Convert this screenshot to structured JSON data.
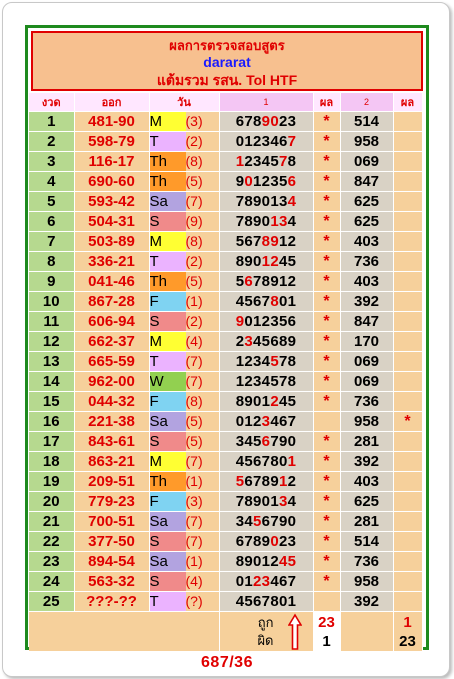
{
  "header": {
    "line1": "ผลการตรวจสอบสูตร",
    "line2": "dararat",
    "line3": "แต้มรวม รสน. Tol HTF"
  },
  "columns": [
    "งวด",
    "ออก",
    "วัน",
    "1",
    "ผล",
    "2",
    "ผล"
  ],
  "day_colors": {
    "M": "#ffff33",
    "T": "#ebb3ff",
    "Th": "#ff9a2a",
    "Sa": "#b2a3e0",
    "S": "#f08a8a",
    "W": "#92d050",
    "F": "#7fd3f2"
  },
  "rows": [
    {
      "n": "1",
      "out": "481-90",
      "day": "M",
      "dnum": "(3)",
      "s1": "6789023",
      "r1": "*",
      "s2": "514",
      "r2": ""
    },
    {
      "n": "2",
      "out": "598-79",
      "day": "T",
      "dnum": "(2)",
      "s1": "0123467",
      "r1": "*",
      "s2": "958",
      "r2": ""
    },
    {
      "n": "3",
      "out": "116-17",
      "day": "Th",
      "dnum": "(8)",
      "s1": "1234578",
      "r1": "*",
      "s2": "069",
      "r2": ""
    },
    {
      "n": "4",
      "out": "690-60",
      "day": "Th",
      "dnum": "(5)",
      "s1": "9012356",
      "r1": "*",
      "s2": "847",
      "r2": ""
    },
    {
      "n": "5",
      "out": "593-42",
      "day": "Sa",
      "dnum": "(7)",
      "s1": "7890134",
      "r1": "*",
      "s2": "625",
      "r2": ""
    },
    {
      "n": "6",
      "out": "504-31",
      "day": "S",
      "dnum": "(9)",
      "s1": "7890134",
      "r1": "*",
      "s2": "625",
      "r2": ""
    },
    {
      "n": "7",
      "out": "503-89",
      "day": "M",
      "dnum": "(8)",
      "s1": "5678912",
      "r1": "*",
      "s2": "403",
      "r2": ""
    },
    {
      "n": "8",
      "out": "336-21",
      "day": "T",
      "dnum": "(2)",
      "s1": "8901245",
      "r1": "*",
      "s2": "736",
      "r2": ""
    },
    {
      "n": "9",
      "out": "041-46",
      "day": "Th",
      "dnum": "(5)",
      "s1": "5678912",
      "r1": "*",
      "s2": "403",
      "r2": ""
    },
    {
      "n": "10",
      "out": "867-28",
      "day": "F",
      "dnum": "(1)",
      "s1": "4567801",
      "r1": "*",
      "s2": "392",
      "r2": ""
    },
    {
      "n": "11",
      "out": "606-94",
      "day": "S",
      "dnum": "(2)",
      "s1": "9012356",
      "r1": "*",
      "s2": "847",
      "r2": ""
    },
    {
      "n": "12",
      "out": "662-37",
      "day": "M",
      "dnum": "(4)",
      "s1": "2345689",
      "r1": "*",
      "s2": "170",
      "r2": ""
    },
    {
      "n": "13",
      "out": "665-59",
      "day": "T",
      "dnum": "(7)",
      "s1": "1234578",
      "r1": "*",
      "s2": "069",
      "r2": ""
    },
    {
      "n": "14",
      "out": "962-00",
      "day": "W",
      "dnum": "(7)",
      "s1": "1234578",
      "r1": "*",
      "s2": "069",
      "r2": ""
    },
    {
      "n": "15",
      "out": "044-32",
      "day": "F",
      "dnum": "(8)",
      "s1": "8901245",
      "r1": "*",
      "s2": "736",
      "r2": ""
    },
    {
      "n": "16",
      "out": "221-38",
      "day": "Sa",
      "dnum": "(5)",
      "s1": "0123467",
      "r1": "",
      "s2": "958",
      "r2": "*"
    },
    {
      "n": "17",
      "out": "843-61",
      "day": "S",
      "dnum": "(5)",
      "s1": "3456790",
      "r1": "*",
      "s2": "281",
      "r2": ""
    },
    {
      "n": "18",
      "out": "863-21",
      "day": "M",
      "dnum": "(7)",
      "s1": "4567801",
      "r1": "*",
      "s2": "392",
      "r2": ""
    },
    {
      "n": "19",
      "out": "209-51",
      "day": "Th",
      "dnum": "(1)",
      "s1": "5678912",
      "r1": "*",
      "s2": "403",
      "r2": ""
    },
    {
      "n": "20",
      "out": "779-23",
      "day": "F",
      "dnum": "(3)",
      "s1": "7890134",
      "r1": "*",
      "s2": "625",
      "r2": ""
    },
    {
      "n": "21",
      "out": "700-51",
      "day": "Sa",
      "dnum": "(7)",
      "s1": "3456790",
      "r1": "*",
      "s2": "281",
      "r2": ""
    },
    {
      "n": "22",
      "out": "377-50",
      "day": "S",
      "dnum": "(7)",
      "s1": "6789023",
      "r1": "*",
      "s2": "514",
      "r2": ""
    },
    {
      "n": "23",
      "out": "894-54",
      "day": "Sa",
      "dnum": "(1)",
      "s1": "8901245",
      "r1": "*",
      "s2": "736",
      "r2": ""
    },
    {
      "n": "24",
      "out": "563-32",
      "day": "S",
      "dnum": "(4)",
      "s1": "0123467",
      "r1": "*",
      "s2": "958",
      "r2": ""
    },
    {
      "n": "25",
      "out": "???-??",
      "day": "T",
      "dnum": "(?)",
      "s1": "4567801",
      "r1": "",
      "s2": "392",
      "r2": ""
    }
  ],
  "footer": {
    "right_label": "ถูก",
    "wrong_label": "ผิด",
    "r1_right": "23",
    "r1_wrong": "1",
    "r2_right": "1",
    "r2_wrong": "23"
  },
  "code": "687/36"
}
